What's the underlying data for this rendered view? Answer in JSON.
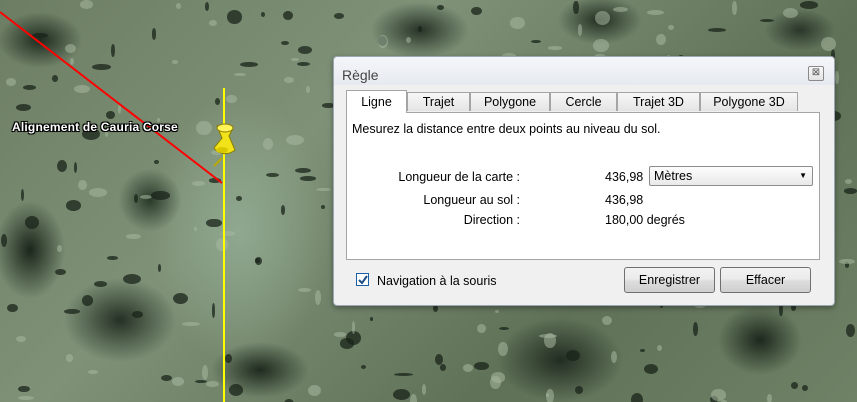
{
  "map": {
    "placemark_label": "Alignement de Cauria Corse",
    "measure_line_color": "#ff0000",
    "meridian_line_color": "#ffff00",
    "pin_color": "#f2e21a"
  },
  "dialog": {
    "title": "Règle",
    "close_icon": "close-icon",
    "tabs": [
      "Ligne",
      "Trajet",
      "Polygone",
      "Cercle",
      "Trajet 3D",
      "Polygone 3D"
    ],
    "active_tab": "Ligne",
    "description": "Mesurez la distance entre deux points au niveau du sol.",
    "rows": {
      "map_length_label": "Longueur de la carte :",
      "map_length_value": "436,98",
      "ground_length_label": "Longueur au sol :",
      "ground_length_value": "436,98",
      "direction_label": "Direction :",
      "direction_value": "180,00 degrés"
    },
    "unit_select": {
      "selected": "Mètres"
    },
    "mouse_nav": {
      "label": "Navigation à la souris",
      "checked": true
    },
    "buttons": {
      "save": "Enregistrer",
      "clear": "Effacer"
    }
  }
}
